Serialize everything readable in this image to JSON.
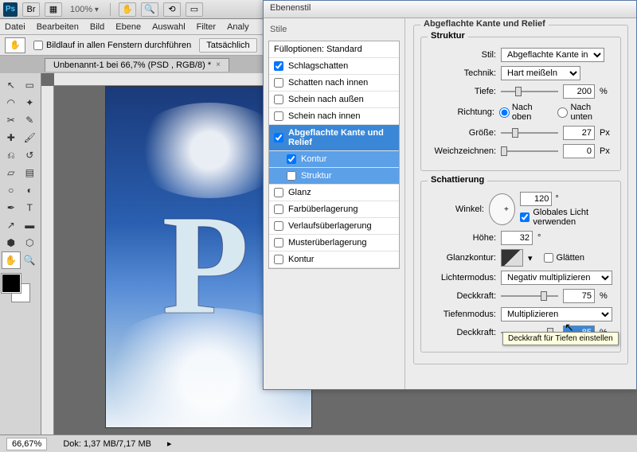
{
  "titlebar": {
    "br_label": "Br",
    "zoom": "100%"
  },
  "menu": [
    "Datei",
    "Bearbeiten",
    "Bild",
    "Ebene",
    "Auswahl",
    "Filter",
    "Analy"
  ],
  "optbar": {
    "scroll_all": "Bildlauf in allen Fenstern durchführen",
    "actual": "Tatsächlich"
  },
  "doctab": {
    "title": "Unbenannt-1 bei 66,7% (PSD      , RGB/8) *"
  },
  "canvas": {
    "letter": "P"
  },
  "status": {
    "zoom": "66,67%",
    "doc": "Dok: 1,37 MB/7,17 MB"
  },
  "dialog": {
    "title": "Ebenenstil",
    "styles_header": "Stile",
    "fill_header": "Fülloptionen: Standard",
    "items": {
      "schlagschatten": "Schlagschatten",
      "schatten_innen": "Schatten nach innen",
      "schein_aussen": "Schein nach außen",
      "schein_innen": "Schein nach innen",
      "bevel": "Abgeflachte Kante und Relief",
      "kontur": "Kontur",
      "struktur_sub": "Struktur",
      "glanz": "Glanz",
      "farbueber": "Farbüberlagerung",
      "verlaufueber": "Verlaufsüberlagerung",
      "musterueber": "Musterüberlagerung",
      "kontur2": "Kontur"
    },
    "panel_title": "Abgeflachte Kante und Relief",
    "struktur": {
      "legend": "Struktur",
      "stil_lbl": "Stil:",
      "stil_val": "Abgeflachte Kante innen",
      "technik_lbl": "Technik:",
      "technik_val": "Hart meißeln",
      "tiefe_lbl": "Tiefe:",
      "tiefe_val": "200",
      "tiefe_unit": "%",
      "richtung_lbl": "Richtung:",
      "richtung_up": "Nach oben",
      "richtung_down": "Nach unten",
      "groesse_lbl": "Größe:",
      "groesse_val": "27",
      "groesse_unit": "Px",
      "weich_lbl": "Weichzeichnen:",
      "weich_val": "0",
      "weich_unit": "Px"
    },
    "schattierung": {
      "legend": "Schattierung",
      "winkel_lbl": "Winkel:",
      "winkel_val": "120",
      "winkel_unit": "°",
      "global_light": "Globales Licht verwenden",
      "hoehe_lbl": "Höhe:",
      "hoehe_val": "32",
      "hoehe_unit": "°",
      "glanzkontur_lbl": "Glanzkontur:",
      "glaetten": "Glätten",
      "lichtermodus_lbl": "Lichtermodus:",
      "lichtermodus_val": "Negativ multiplizieren",
      "deckkraft1_lbl": "Deckkraft:",
      "deckkraft1_val": "75",
      "deckkraft1_unit": "%",
      "tiefenmodus_lbl": "Tiefenmodus:",
      "tiefenmodus_val": "Multiplizieren",
      "deckkraft2_lbl": "Deckkraft:",
      "deckkraft2_val": "85",
      "deckkraft2_unit": "%"
    },
    "tooltip": "Deckkraft für Tiefen einstellen"
  }
}
